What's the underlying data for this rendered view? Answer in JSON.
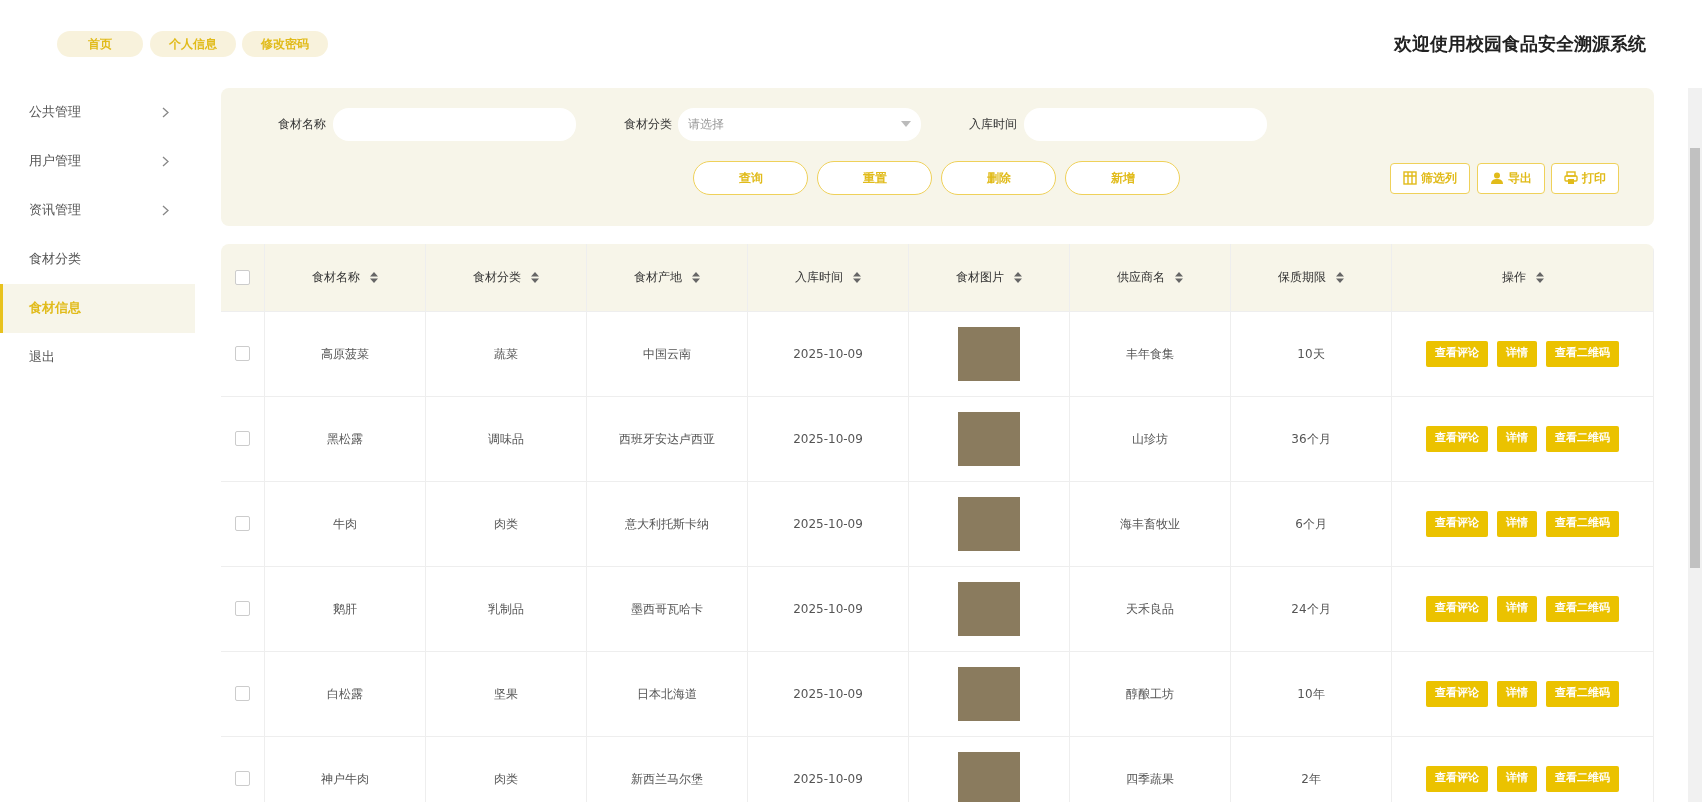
{
  "top_nav": [
    {
      "label": "首页"
    },
    {
      "label": "个人信息"
    },
    {
      "label": "修改密码"
    }
  ],
  "title": "欢迎使用校园食品安全溯源系统",
  "sidebar": {
    "items": [
      {
        "label": "公共管理",
        "expandable": true,
        "selected": false
      },
      {
        "label": "用户管理",
        "expandable": true,
        "selected": false
      },
      {
        "label": "资讯管理",
        "expandable": true,
        "selected": false
      },
      {
        "label": "食材分类",
        "expandable": false,
        "selected": false
      },
      {
        "label": "食材信息",
        "expandable": false,
        "selected": true
      },
      {
        "label": "退出",
        "expandable": false,
        "selected": false
      }
    ]
  },
  "search": {
    "fields": [
      {
        "label": "食材名称",
        "kind": "text"
      },
      {
        "label": "食材分类",
        "kind": "select",
        "placeholder": "请选择"
      },
      {
        "label": "入库时间",
        "kind": "text"
      }
    ],
    "buttons": [
      "查询",
      "重置",
      "删除",
      "新增"
    ],
    "tools": [
      {
        "label": "筛选列"
      },
      {
        "label": "导出"
      },
      {
        "label": "打印"
      }
    ]
  },
  "table": {
    "select_all": {
      "checked": false
    },
    "columns": [
      "食材名称",
      "食材分类",
      "食材产地",
      "入库时间",
      "食材图片",
      "供应商名",
      "保质期限",
      "操作"
    ],
    "rows": [
      {
        "checked": false,
        "cells": [
          "高原菠菜",
          "蔬菜",
          "中国云南",
          "2025-10-09",
          "",
          "丰年食集",
          "10天"
        ],
        "actions": [
          "查看评论",
          "详情",
          "查看二维码"
        ]
      },
      {
        "checked": false,
        "cells": [
          "黑松露",
          "调味品",
          "西班牙安达卢西亚",
          "2025-10-09",
          "",
          "山珍坊",
          "36个月"
        ],
        "actions": [
          "查看评论",
          "详情",
          "查看二维码"
        ]
      },
      {
        "checked": false,
        "cells": [
          "牛肉",
          "肉类",
          "意大利托斯卡纳",
          "2025-10-09",
          "",
          "海丰畜牧业",
          "6个月"
        ],
        "actions": [
          "查看评论",
          "详情",
          "查看二维码"
        ]
      },
      {
        "checked": false,
        "cells": [
          "鹅肝",
          "乳制品",
          "墨西哥瓦哈卡",
          "2025-10-09",
          "",
          "天禾良品",
          "24个月"
        ],
        "actions": [
          "查看评论",
          "详情",
          "查看二维码"
        ]
      },
      {
        "checked": false,
        "cells": [
          "白松露",
          "坚果",
          "日本北海道",
          "2025-10-09",
          "",
          "醇酿工坊",
          "10年"
        ],
        "actions": [
          "查看评论",
          "详情",
          "查看二维码"
        ]
      },
      {
        "checked": false,
        "cells": [
          "神户牛肉",
          "肉类",
          "新西兰马尔堡",
          "2025-10-09",
          "",
          "四季蔬果",
          "2年"
        ],
        "actions": [
          "查看评论",
          "详情",
          "查看二维码"
        ]
      }
    ]
  }
}
